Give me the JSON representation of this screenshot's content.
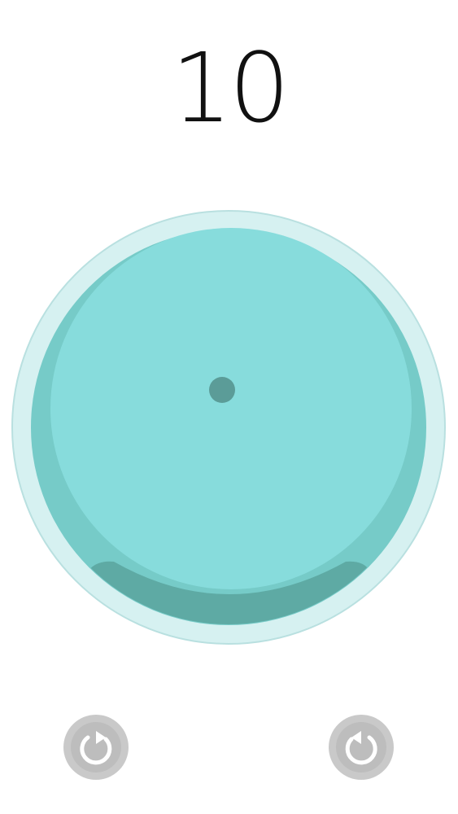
{
  "score": {
    "value": "10"
  },
  "board": {
    "colors": {
      "outer_ring": "#d6f1f1",
      "outer_ring_edge": "#b9e0e0",
      "rim": "#76cbc8",
      "inner_face": "#87dcdc",
      "liquid": "#5eaaa4",
      "ball": "#5b9c98"
    },
    "ball_icon": "ball-dot"
  },
  "controls": {
    "rotate_left": {
      "icon": "rotate-clockwise-icon",
      "color": "#c9c9c9"
    },
    "rotate_right": {
      "icon": "rotate-counterclockwise-icon",
      "color": "#c9c9c9"
    }
  }
}
